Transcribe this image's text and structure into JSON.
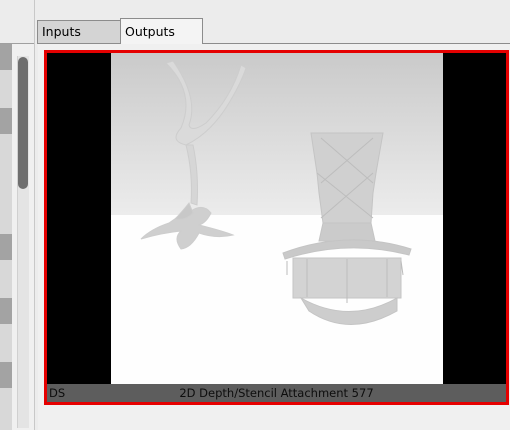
{
  "tabs": [
    {
      "label": "Inputs",
      "active": false
    },
    {
      "label": "Outputs",
      "active": true
    }
  ],
  "output": {
    "tag": "DS",
    "name": "2D Depth/Stencil Attachment 577",
    "selected": true,
    "highlight_color": "#e50000"
  }
}
